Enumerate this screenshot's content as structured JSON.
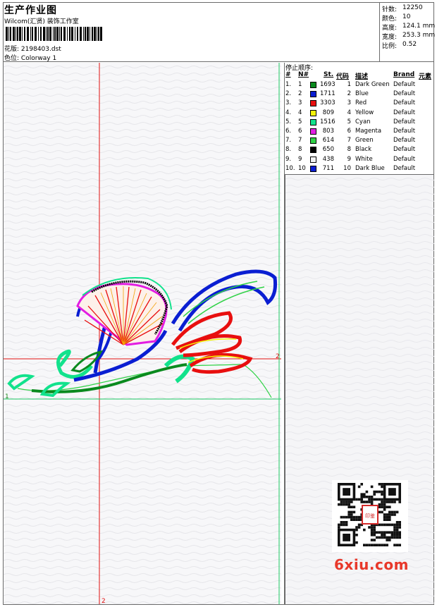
{
  "header": {
    "title": "生产作业图",
    "company": "Wilcom(汇贤) 装饰工作室",
    "design_label": "花版:",
    "design_value": "2198403.dst",
    "colorway_label": "色位:",
    "colorway_value": "Colorway 1"
  },
  "stats": [
    {
      "label": "针数:",
      "value": "12250"
    },
    {
      "label": "颜色:",
      "value": "10"
    },
    {
      "label": "高度:",
      "value": "124.1 mm"
    },
    {
      "label": "宽度:",
      "value": "253.3 mm"
    },
    {
      "label": "比例:",
      "value": "0.52"
    }
  ],
  "stop_sequence": {
    "title": "停止顺序:",
    "headers": {
      "hash": "#",
      "n": "N#",
      "st": "St.",
      "code": "代码",
      "desc": "描述",
      "brand": "Brand",
      "elem": "元素"
    },
    "rows": [
      {
        "idx": "1.",
        "n": "1",
        "st": "1693",
        "code": "1",
        "desc": "Dark Green",
        "brand": "Default",
        "color": "#0a8a1e"
      },
      {
        "idx": "2.",
        "n": "2",
        "st": "1711",
        "code": "2",
        "desc": "Blue",
        "brand": "Default",
        "color": "#0a1ed2"
      },
      {
        "idx": "3.",
        "n": "3",
        "st": "3303",
        "code": "3",
        "desc": "Red",
        "brand": "Default",
        "color": "#e80f0f"
      },
      {
        "idx": "4.",
        "n": "4",
        "st": "809",
        "code": "4",
        "desc": "Yellow",
        "brand": "Default",
        "color": "#f3f30a"
      },
      {
        "idx": "5.",
        "n": "5",
        "st": "1516",
        "code": "5",
        "desc": "Cyan",
        "brand": "Default",
        "color": "#12e28c"
      },
      {
        "idx": "6.",
        "n": "6",
        "st": "803",
        "code": "6",
        "desc": "Magenta",
        "brand": "Default",
        "color": "#e21ee2"
      },
      {
        "idx": "7.",
        "n": "7",
        "st": "614",
        "code": "7",
        "desc": "Green",
        "brand": "Default",
        "color": "#2fd246"
      },
      {
        "idx": "8.",
        "n": "8",
        "st": "650",
        "code": "8",
        "desc": "Black",
        "brand": "Default",
        "color": "#000000"
      },
      {
        "idx": "9.",
        "n": "9",
        "st": "438",
        "code": "9",
        "desc": "White",
        "brand": "Default",
        "color": "#f2f2f2"
      },
      {
        "idx": "10.",
        "n": "10",
        "st": "711",
        "code": "10",
        "desc": "Dark Blue",
        "brand": "Default",
        "color": "#0a1ed2"
      }
    ]
  },
  "canvas": {
    "marker_1": "1",
    "marker_2_right": "2",
    "marker_2_bottom": "2"
  },
  "watermark": {
    "logo": "6xiu.com",
    "seal": "印鉴"
  },
  "colors": {
    "border": "#6b6b6b",
    "guide_red": "#e01010",
    "guide_green": "#1ec864",
    "logo": "#e8382a"
  }
}
